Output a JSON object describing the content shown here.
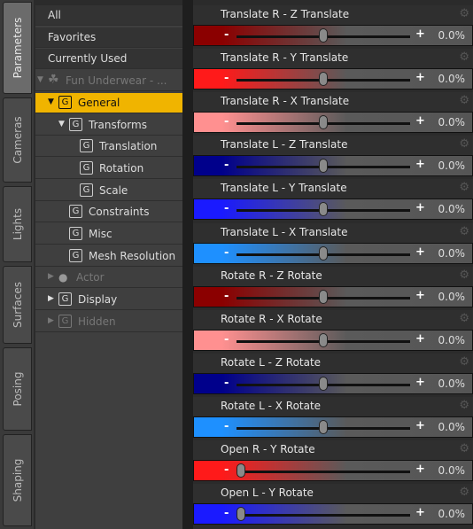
{
  "tabs": [
    "Parameters",
    "Cameras",
    "Lights",
    "Surfaces",
    "Posing",
    "Shaping"
  ],
  "tree": [
    {
      "label": "All",
      "indent": 0,
      "type": "text"
    },
    {
      "label": "Favorites",
      "indent": 0,
      "type": "text"
    },
    {
      "label": "Currently Used",
      "indent": 0,
      "type": "text"
    },
    {
      "label": "Fun Underwear - ...",
      "indent": 0,
      "type": "figure",
      "dim": true,
      "expanded": true
    },
    {
      "label": "General",
      "indent": 1,
      "type": "group",
      "selected": true,
      "expanded": true
    },
    {
      "label": "Transforms",
      "indent": 2,
      "type": "group",
      "expanded": true
    },
    {
      "label": "Translation",
      "indent": 3,
      "type": "group"
    },
    {
      "label": "Rotation",
      "indent": 3,
      "type": "group"
    },
    {
      "label": "Scale",
      "indent": 3,
      "type": "group"
    },
    {
      "label": "Constraints",
      "indent": 2,
      "type": "group"
    },
    {
      "label": "Misc",
      "indent": 2,
      "type": "group"
    },
    {
      "label": "Mesh Resolution",
      "indent": 2,
      "type": "group"
    },
    {
      "label": "Actor",
      "indent": 1,
      "type": "person",
      "dim": true,
      "collapsed": true
    },
    {
      "label": "Display",
      "indent": 1,
      "type": "group",
      "collapsed": true
    },
    {
      "label": "Hidden",
      "indent": 1,
      "type": "group",
      "dim": true,
      "collapsed": true
    }
  ],
  "params": [
    {
      "name": "Translate R - Z Translate",
      "value": "0.0%",
      "level": 0.5,
      "color": "#8b0000"
    },
    {
      "name": "Translate R - Y Translate",
      "value": "0.0%",
      "level": 0.5,
      "color": "#ff1a1a"
    },
    {
      "name": "Translate R - X Translate",
      "value": "0.0%",
      "level": 0.5,
      "color": "#ff9090"
    },
    {
      "name": "Translate L - Z Translate",
      "value": "0.0%",
      "level": 0.5,
      "color": "#00008b"
    },
    {
      "name": "Translate L - Y Translate",
      "value": "0.0%",
      "level": 0.5,
      "color": "#1a1aff"
    },
    {
      "name": "Translate L - X Translate",
      "value": "0.0%",
      "level": 0.5,
      "color": "#1e90ff"
    },
    {
      "name": "Rotate R - Z Rotate",
      "value": "0.0%",
      "level": 0.5,
      "color": "#8b0000"
    },
    {
      "name": "Rotate R - X Rotate",
      "value": "0.0%",
      "level": 0.5,
      "color": "#ff9090"
    },
    {
      "name": "Rotate L - Z Rotate",
      "value": "0.0%",
      "level": 0.5,
      "color": "#00008b"
    },
    {
      "name": "Rotate L - X Rotate",
      "value": "0.0%",
      "level": 0.5,
      "color": "#1e90ff"
    },
    {
      "name": "Open R - Y Rotate",
      "value": "0.0%",
      "level": 0.0,
      "color": "#ff1a1a"
    },
    {
      "name": "Open L - Y Rotate",
      "value": "0.0%",
      "level": 0.0,
      "color": "#1a1aff"
    }
  ]
}
